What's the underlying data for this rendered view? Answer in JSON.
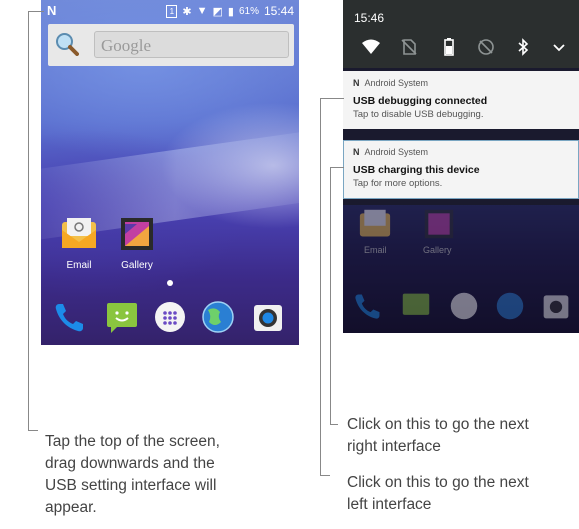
{
  "left_phone": {
    "status": {
      "notif_icon": "N",
      "sim": "1",
      "battery": "61%",
      "time": "15:44"
    },
    "search": {
      "placeholder": "Google"
    },
    "apps": [
      {
        "label": "Email",
        "icon": "email-icon"
      },
      {
        "label": "Gallery",
        "icon": "gallery-icon"
      }
    ],
    "dock": [
      "phone-icon",
      "messaging-icon",
      "app-drawer-icon",
      "browser-icon",
      "camera-icon"
    ]
  },
  "right_phone": {
    "time": "15:46",
    "quick_settings": [
      "wifi-icon",
      "no-sim-icon",
      "battery-icon",
      "do-not-disturb-icon",
      "bluetooth-icon",
      "expand-icon"
    ],
    "notifications": [
      {
        "source": "Android System",
        "title": "USB debugging connected",
        "subtitle": "Tap to disable USB debugging."
      },
      {
        "source": "Android System",
        "title": "USB charging this device",
        "subtitle": "Tap for more options."
      }
    ],
    "apps": [
      "Email",
      "Gallery"
    ]
  },
  "captions": {
    "left": [
      "Tap the top of the screen,",
      "drag downwards and the",
      "USB setting interface will",
      "appear."
    ],
    "right_top": [
      "Click on this to go the next",
      "right interface"
    ],
    "right_bottom": [
      "Click on this to go the next",
      "left interface"
    ]
  },
  "colors": {
    "accent_notification_border": "#7aa6c2",
    "caption_text": "#444444"
  }
}
